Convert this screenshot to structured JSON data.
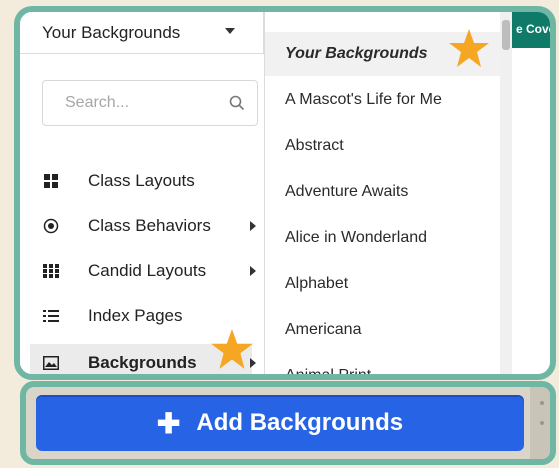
{
  "dropdown": {
    "selected": "Your Backgrounds"
  },
  "search": {
    "placeholder": "Search..."
  },
  "nav": [
    {
      "label": "Class Layouts",
      "icon": "grid-icon"
    },
    {
      "label": "Class Behaviors",
      "icon": "target-icon"
    },
    {
      "label": "Candid Layouts",
      "icon": "tiles-icon"
    },
    {
      "label": "Index Pages",
      "icon": "list-icon"
    },
    {
      "label": "Backgrounds",
      "icon": "image-icon",
      "active": true
    }
  ],
  "submenu": [
    "Your Backgrounds",
    "A Mascot's Life for Me",
    "Abstract",
    "Adventure Awaits",
    "Alice in Wonderland",
    "Alphabet",
    "Americana",
    "Animal Print"
  ],
  "banner": {
    "text": "e Cove"
  },
  "bottom": {
    "button_label": "Add Backgrounds"
  },
  "colors": {
    "accent": "#2764e5",
    "frame": "#6fb7a4",
    "star": "#f5a623",
    "banner": "#0f7a68"
  }
}
